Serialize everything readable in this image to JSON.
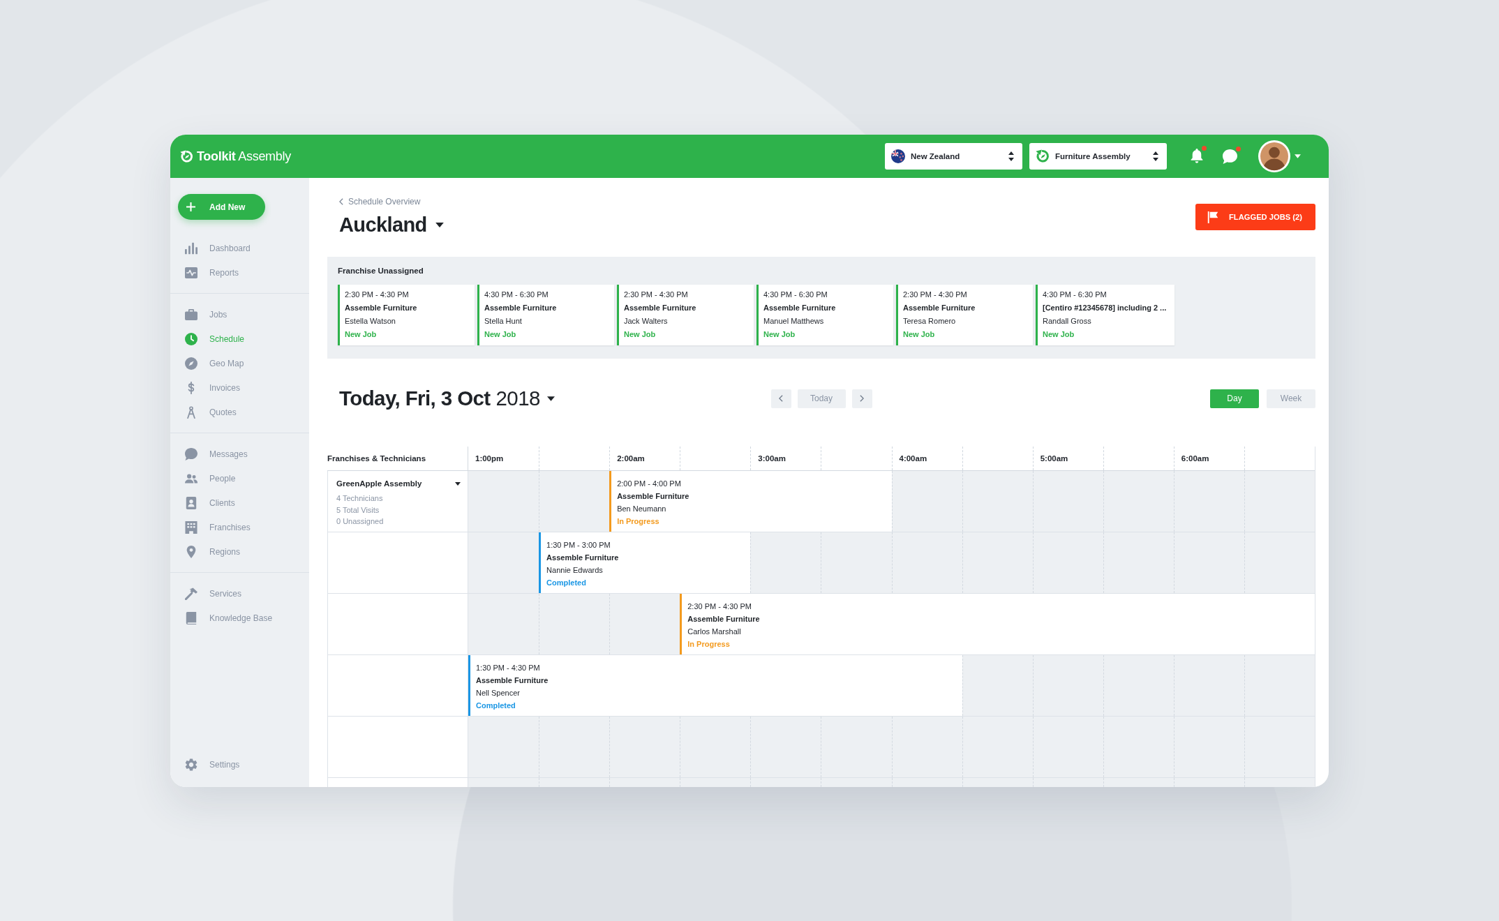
{
  "header": {
    "logo": "**Toolkit** Assembly",
    "region_select": {
      "value": "New Zealand"
    },
    "business_select": {
      "value": "Furniture Assembly"
    },
    "notifications": {
      "unread": true
    },
    "messages": {
      "unread": true
    }
  },
  "sidebar": {
    "add_button": "Add New",
    "sections": [
      {
        "items": [
          {
            "label": "Dashboard",
            "selected": false
          },
          {
            "label": "Reports",
            "selected": false
          }
        ]
      },
      {
        "items": [
          {
            "label": "Jobs",
            "selected": false
          },
          {
            "label": "Schedule",
            "selected": true
          },
          {
            "label": "Geo Map",
            "selected": false
          },
          {
            "label": "Invoices",
            "selected": false
          },
          {
            "label": "Quotes",
            "selected": false
          }
        ]
      },
      {
        "items": [
          {
            "label": "Messages",
            "selected": false
          },
          {
            "label": "People",
            "selected": false
          },
          {
            "label": "Clients",
            "selected": false
          },
          {
            "label": "Franchises",
            "selected": false
          },
          {
            "label": "Regions",
            "selected": false
          }
        ]
      },
      {
        "items": [
          {
            "label": "Services",
            "selected": false
          },
          {
            "label": "Knowledge Base",
            "selected": false
          }
        ]
      }
    ],
    "settings": {
      "label": "Settings",
      "selected": false
    }
  },
  "page": {
    "breadcrumb": "Schedule Overview",
    "title": "Auckland",
    "flagged_button": "FLAGGED JOBS (2)"
  },
  "unassigned": {
    "title": "Franchise Unassigned",
    "jobs": [
      {
        "time": "2:30 PM - 4:30 PM",
        "service": "Assemble Furniture",
        "client": "Estella Watson",
        "status": "New Job"
      },
      {
        "time": "4:30 PM - 6:30 PM",
        "service": "Assemble Furniture",
        "client": "Stella Hunt",
        "status": "New Job"
      },
      {
        "time": "2:30 PM - 4:30 PM",
        "service": "Assemble Furniture",
        "client": "Jack Walters",
        "status": "New Job"
      },
      {
        "time": "4:30 PM - 6:30 PM",
        "service": "Assemble Furniture",
        "client": "Manuel Matthews",
        "status": "New Job"
      },
      {
        "time": "2:30 PM - 4:30 PM",
        "service": "Assemble Furniture",
        "client": "Teresa Romero",
        "status": "New Job"
      },
      {
        "time": "4:30 PM - 6:30 PM",
        "service": "[Centiro #12345678] including 2 ...",
        "client": "Randall Gross",
        "status": "New Job"
      }
    ]
  },
  "schedule": {
    "date": "**Today, Fri, 3 Oct** 2018",
    "today_button": "Today",
    "views": [
      {
        "label": "Day",
        "selected": true
      },
      {
        "label": "Week",
        "selected": false
      }
    ],
    "column_heading": "Franchises & Technicians",
    "hours": [
      "1:00pm",
      "2:00am",
      "3:00am",
      "4:00am",
      "5:00am",
      "6:00am"
    ],
    "franchise": {
      "name": "GreenApple Assembly",
      "stats": [
        "4 Technicians",
        "5 Total Visits",
        "0 Unassigned"
      ]
    },
    "visits": [
      {
        "time": "2:00 PM - 4:00 PM",
        "service": "Assemble Furniture",
        "technician": "Ben Neumann",
        "status": "In Progress",
        "kind": "in_progress"
      },
      {
        "time": "1:30 PM - 3:00 PM",
        "service": "Assemble Furniture",
        "technician": "Nannie Edwards",
        "status": "Completed",
        "kind": "completed"
      },
      {
        "time": "2:30 PM - 4:30 PM",
        "service": "Assemble Furniture",
        "technician": "Carlos Marshall",
        "status": "In Progress",
        "kind": "in_progress"
      },
      {
        "time": "1:30 PM - 4:30 PM",
        "service": "Assemble Furniture",
        "technician": "Nell Spencer",
        "status": "Completed",
        "kind": "completed"
      }
    ]
  }
}
